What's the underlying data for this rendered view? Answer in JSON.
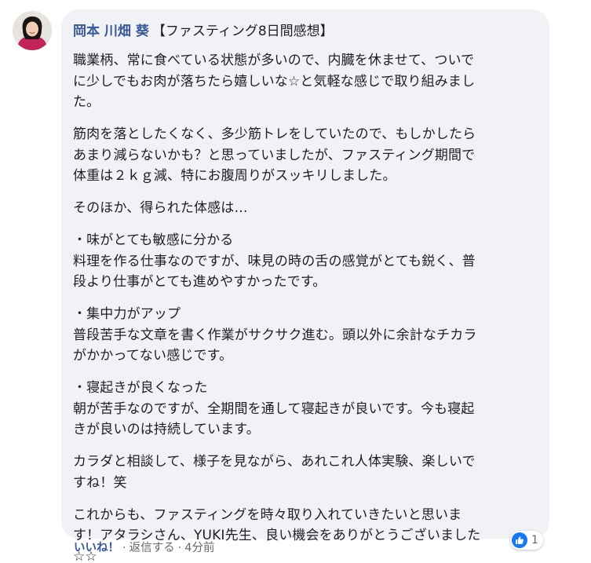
{
  "comment": {
    "author": "岡本 川畑 葵",
    "title": "【ファスティング8日間感想】",
    "paragraphs": [
      "職業柄、常に食べている状態が多いので、内臓を休ませて、ついで\nに少しでもお肉が落ちたら嬉しいな☆と気軽な感じで取り組みまし\nた。",
      "筋肉を落としたくなく、多少筋トレをしていたので、もしかしたら\nあまり減らないかも？と思っていましたが、ファスティング期間で\n体重は２ｋｇ減、特にお腹周りがスッキリしました。",
      "そのほか、得られた体感は…",
      "・味がとても敏感に分かる\n料理を作る仕事なのですが、味見の時の舌の感覚がとても鋭く、普\n段より仕事がとても進めやすかったです。",
      "・集中力がアップ\n普段苦手な文章を書く作業がサクサク進む。頭以外に余計なチカラ\nがかかってない感じです。",
      "・寝起きが良くなった\n朝が苦手なのですが、全期間を通して寝起きが良いです。今も寝起\nきが良いのは持続しています。",
      "カラダと相談して、様子を見ながら、あれこれ人体実験、楽しいで\nすね！笑",
      "これからも、ファスティングを時々取り入れていきたいと思いま\nす！アタラシさん、YUKI先生、良い機会をありがとうございました\n☆☆"
    ]
  },
  "actions": {
    "like_label": "いいね！",
    "separator": "·",
    "reply_label": "返信する",
    "time": "4分前"
  },
  "reactions": {
    "icon": "thumbs-up-icon",
    "count": "1"
  },
  "colors": {
    "bubble_bg": "#f0f2f5",
    "link": "#385898",
    "meta_text": "#65676b",
    "like_blue": "#1877f2"
  }
}
